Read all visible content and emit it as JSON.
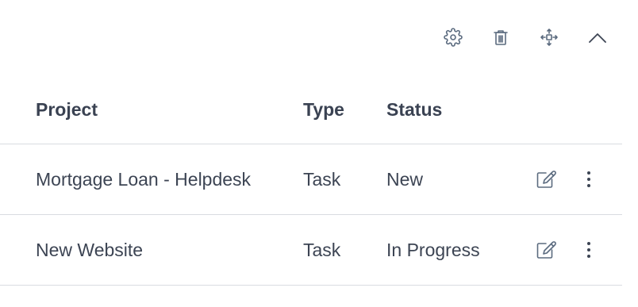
{
  "toolbar": {
    "icons": [
      "gear-icon",
      "trash-icon",
      "move-icon",
      "chevron-up-icon"
    ]
  },
  "table": {
    "columns": [
      "Project",
      "Type",
      "Status"
    ],
    "rows": [
      {
        "project": "Mortgage Loan - Helpdesk",
        "type": "Task",
        "status": "New"
      },
      {
        "project": "New Website",
        "type": "Task",
        "status": "In Progress"
      }
    ]
  },
  "colors": {
    "text": "#3c4453",
    "icon": "#5b6b7f",
    "divider": "#d9dce1"
  }
}
